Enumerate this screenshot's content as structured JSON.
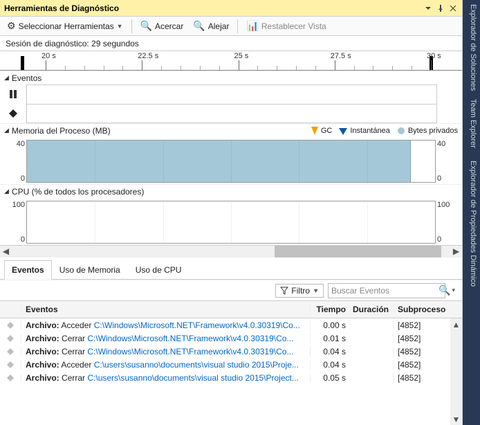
{
  "window": {
    "title": "Herramientas de Diagnóstico"
  },
  "toolbar": {
    "select_tools": "Seleccionar Herramientas",
    "zoom_in": "Acercar",
    "zoom_out": "Alejar",
    "reset": "Restablecer Vista"
  },
  "session": {
    "label": "Sesión de diagnóstico: 29 segundos"
  },
  "ruler": {
    "labels": [
      "20 s",
      "22.5 s",
      "25 s",
      "27.5 s",
      "30 s"
    ]
  },
  "sections": {
    "events": {
      "title": "Eventos"
    },
    "memory": {
      "title": "Memoria del Proceso (MB)",
      "legend": {
        "gc": "GC",
        "snapshot": "Instantánea",
        "private": "Bytes privados"
      },
      "ymax": "40",
      "ymin": "0"
    },
    "cpu": {
      "title": "CPU (% de todos los procesadores)",
      "ymax": "100",
      "ymin": "0"
    }
  },
  "tabs": {
    "events": "Eventos",
    "memory": "Uso de Memoria",
    "cpu": "Uso de CPU"
  },
  "filter": {
    "button": "Filtro",
    "search_placeholder": "Buscar Eventos"
  },
  "table": {
    "cols": {
      "events": "Eventos",
      "time": "Tiempo",
      "duration": "Duración",
      "subprocess": "Subproceso"
    },
    "rows": [
      {
        "prefix": "Archivo:",
        "action": "Acceder",
        "path": "C:\\Windows\\Microsoft.NET\\Framework\\v4.0.30319\\Co...",
        "time": "0.00 s",
        "dur": "",
        "sub": "[4852]"
      },
      {
        "prefix": "Archivo:",
        "action": "Cerrar",
        "path": "C:\\Windows\\Microsoft.NET\\Framework\\v4.0.30319\\Co...",
        "time": "0.01 s",
        "dur": "",
        "sub": "[4852]"
      },
      {
        "prefix": "Archivo:",
        "action": "Cerrar",
        "path": "C:\\Windows\\Microsoft.NET\\Framework\\v4.0.30319\\Co...",
        "time": "0.04 s",
        "dur": "",
        "sub": "[4852]"
      },
      {
        "prefix": "Archivo:",
        "action": "Acceder",
        "path": "C:\\users\\susanno\\documents\\visual studio 2015\\Proje...",
        "time": "0.04 s",
        "dur": "",
        "sub": "[4852]"
      },
      {
        "prefix": "Archivo:",
        "action": "Cerrar",
        "path": "C:\\users\\susanno\\documents\\visual studio 2015\\Project...",
        "time": "0.05 s",
        "dur": "",
        "sub": "[4852]"
      }
    ]
  },
  "side_tabs": {
    "solutions": "Explorador de Soluciones",
    "team": "Team Explorer",
    "props": "Explorador de Propiedades Dinámico"
  },
  "chart_data": [
    {
      "type": "area",
      "title": "Memoria del Proceso (MB)",
      "ylabel": "MB",
      "ylim": [
        0,
        40
      ],
      "x": [
        19,
        20,
        22.5,
        25,
        27.5,
        30,
        30.7
      ],
      "series": [
        {
          "name": "Bytes privados",
          "values": [
            40,
            40,
            40,
            40,
            40,
            40,
            40
          ]
        }
      ]
    },
    {
      "type": "line",
      "title": "CPU (% de todos los procesadores)",
      "ylabel": "%",
      "ylim": [
        0,
        100
      ],
      "x": [
        19,
        20,
        22.5,
        25,
        27.5,
        30,
        31
      ],
      "series": [
        {
          "name": "CPU",
          "values": [
            0,
            0,
            0,
            0,
            0,
            0,
            0
          ]
        }
      ]
    }
  ]
}
